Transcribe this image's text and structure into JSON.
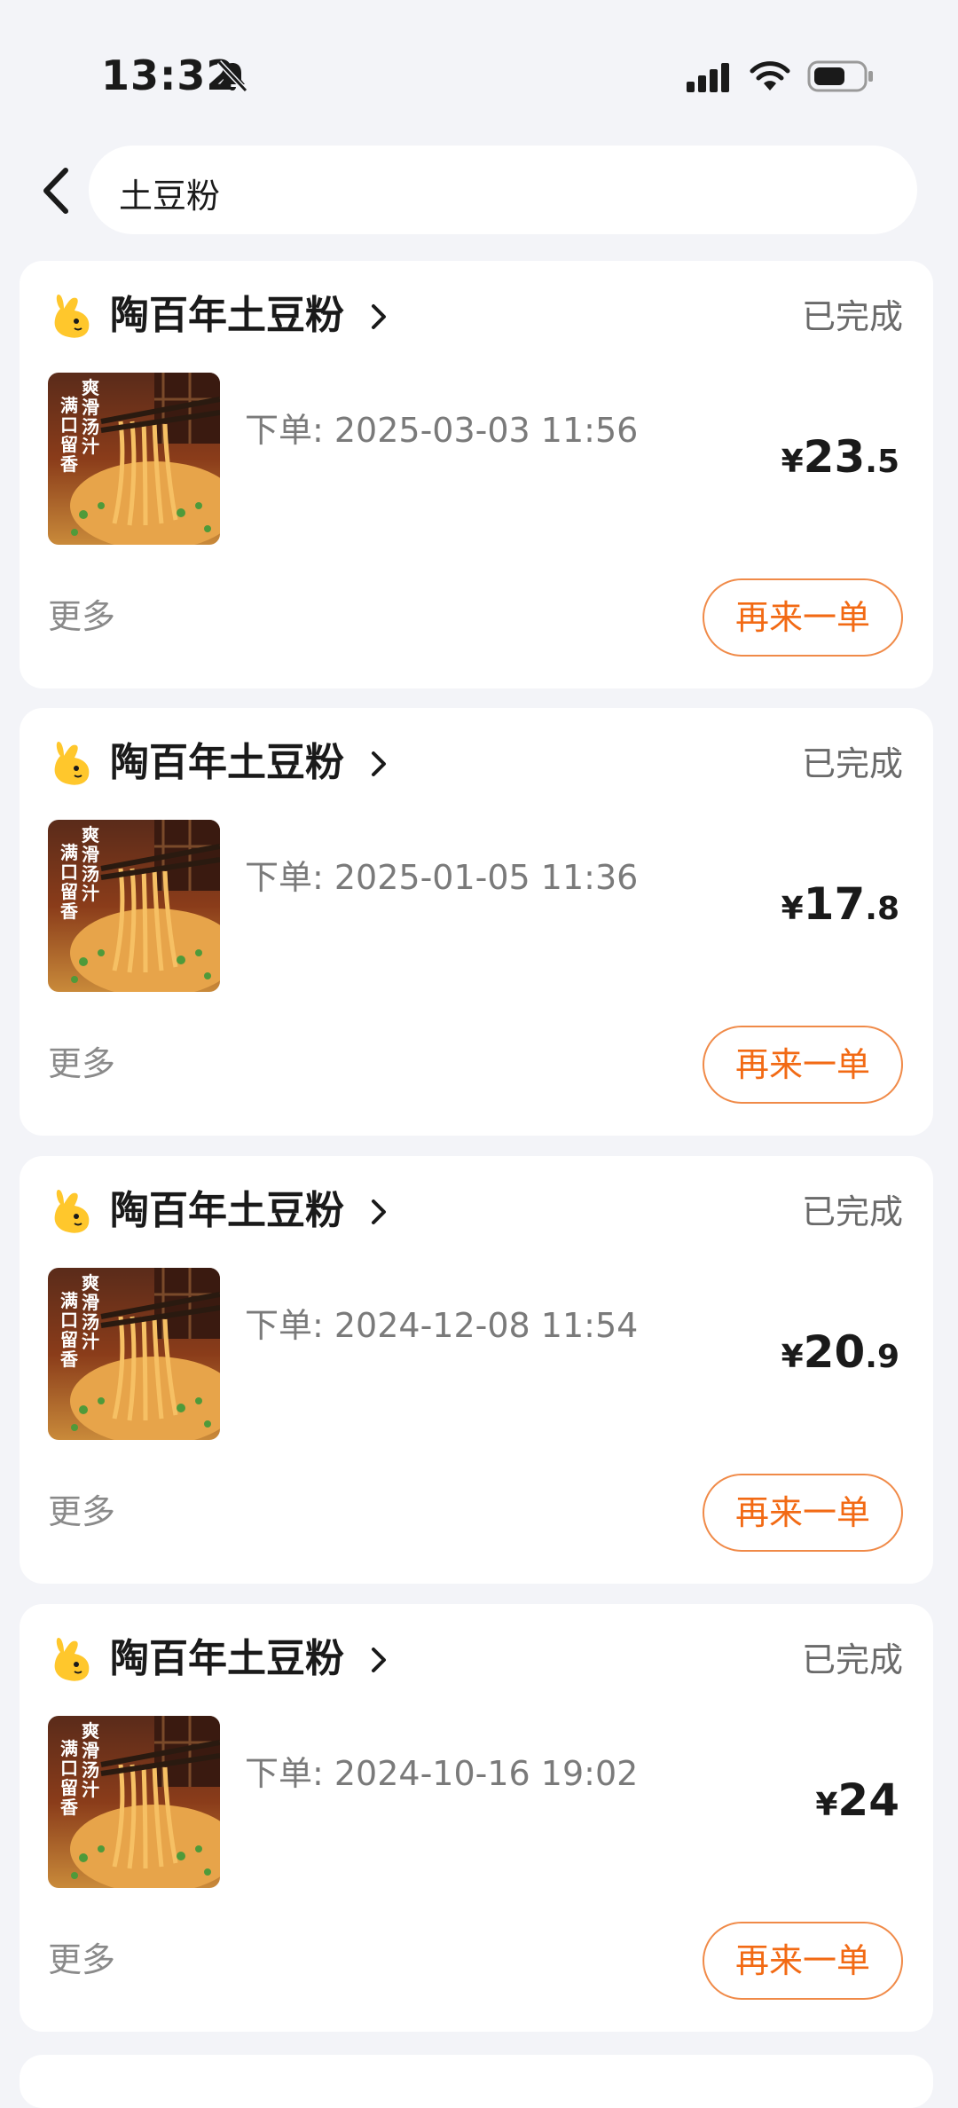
{
  "status_bar": {
    "time": "13:32",
    "icons": [
      "bell-off-icon",
      "signal-icon",
      "wifi-icon",
      "battery-icon"
    ]
  },
  "search": {
    "query": "土豆粉",
    "back_icon": "chevron-left-icon"
  },
  "colors": {
    "background": "#f3f4f8",
    "card": "#ffffff",
    "accent": "#f26a14",
    "accent_border": "#f08a48",
    "muted_text": "#7a7a7a"
  },
  "orders": [
    {
      "shop_name": "陶百年土豆粉",
      "status": "已完成",
      "order_time": "下单: 2025-03-03 11:56",
      "price_currency": "¥",
      "price_int": "23",
      "price_dec": ".5",
      "more_label": "更多",
      "reorder_label": "再来一单",
      "thumb_text": [
        "爽",
        "滑",
        "汤",
        "汁",
        "满",
        "口",
        "留",
        "香"
      ]
    },
    {
      "shop_name": "陶百年土豆粉",
      "status": "已完成",
      "order_time": "下单: 2025-01-05 11:36",
      "price_currency": "¥",
      "price_int": "17",
      "price_dec": ".8",
      "more_label": "更多",
      "reorder_label": "再来一单",
      "thumb_text": [
        "爽",
        "滑",
        "汤",
        "汁",
        "满",
        "口",
        "留",
        "香"
      ]
    },
    {
      "shop_name": "陶百年土豆粉",
      "status": "已完成",
      "order_time": "下单: 2024-12-08 11:54",
      "price_currency": "¥",
      "price_int": "20",
      "price_dec": ".9",
      "more_label": "更多",
      "reorder_label": "再来一单",
      "thumb_text": [
        "爽",
        "滑",
        "汤",
        "汁",
        "满",
        "口",
        "留",
        "香"
      ]
    },
    {
      "shop_name": "陶百年土豆粉",
      "status": "已完成",
      "order_time": "下单: 2024-10-16 19:02",
      "price_currency": "¥",
      "price_int": "24",
      "price_dec": "",
      "more_label": "更多",
      "reorder_label": "再来一单",
      "thumb_text": [
        "爽",
        "滑",
        "汤",
        "汁",
        "满",
        "口",
        "留",
        "香"
      ]
    }
  ]
}
